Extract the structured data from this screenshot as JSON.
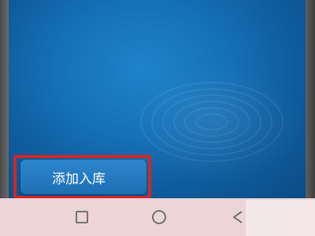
{
  "main": {
    "add_to_library_label": "添加入库"
  },
  "navigation": {
    "buttons": [
      "recent-apps",
      "home",
      "back"
    ]
  },
  "colors": {
    "wallpaper": "#1570b6",
    "button": "#2478bd",
    "highlight_border": "#d42626",
    "nav_bar": "#ecd4d7"
  }
}
